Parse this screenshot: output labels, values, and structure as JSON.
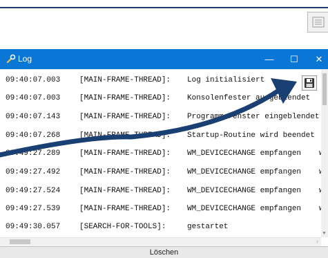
{
  "colors": {
    "titlebar": "#0a77d6",
    "annotation_arrow": "#1a3f73"
  },
  "background_app": {
    "menu_icon": "hamburger-menu-icon"
  },
  "window": {
    "title": "Log",
    "controls": {
      "minimize": "—",
      "maximize": "☐",
      "close": "✕"
    }
  },
  "log": {
    "entries": [
      {
        "time": "09:40:07.003",
        "thread": "[MAIN-FRAME-THREAD]:",
        "message": "Log initialisiert",
        "extra": ""
      },
      {
        "time": "09:40:07.003",
        "thread": "[MAIN-FRAME-THREAD]:",
        "message": "Konsolenfester ausgeblendet",
        "extra": ""
      },
      {
        "time": "09:40:07.143",
        "thread": "[MAIN-FRAME-THREAD]:",
        "message": "Programm-Fenster eingeblendet",
        "extra": ""
      },
      {
        "time": "09:40:07.268",
        "thread": "[MAIN-FRAME-THREAD]:",
        "message": "Startup-Routine wird beendet",
        "extra": ""
      },
      {
        "time": "09:49:27.289",
        "thread": "[MAIN-FRAME-THREAD]:",
        "message": "WM_DEVICECHANGE empfangen",
        "extra": "w"
      },
      {
        "time": "09:49:27.492",
        "thread": "[MAIN-FRAME-THREAD]:",
        "message": "WM_DEVICECHANGE empfangen",
        "extra": "w"
      },
      {
        "time": "09:49:27.524",
        "thread": "[MAIN-FRAME-THREAD]:",
        "message": "WM_DEVICECHANGE empfangen",
        "extra": "w"
      },
      {
        "time": "09:49:27.539",
        "thread": "[MAIN-FRAME-THREAD]:",
        "message": "WM_DEVICECHANGE empfangen",
        "extra": "w"
      },
      {
        "time": "09:49:30.057",
        "thread": "[SEARCH-FOR-TOOLS]:",
        "message": "gestartet",
        "extra": ""
      }
    ],
    "save_icon": "floppy-disk-icon"
  },
  "footer": {
    "clear_label": "Löschen"
  }
}
